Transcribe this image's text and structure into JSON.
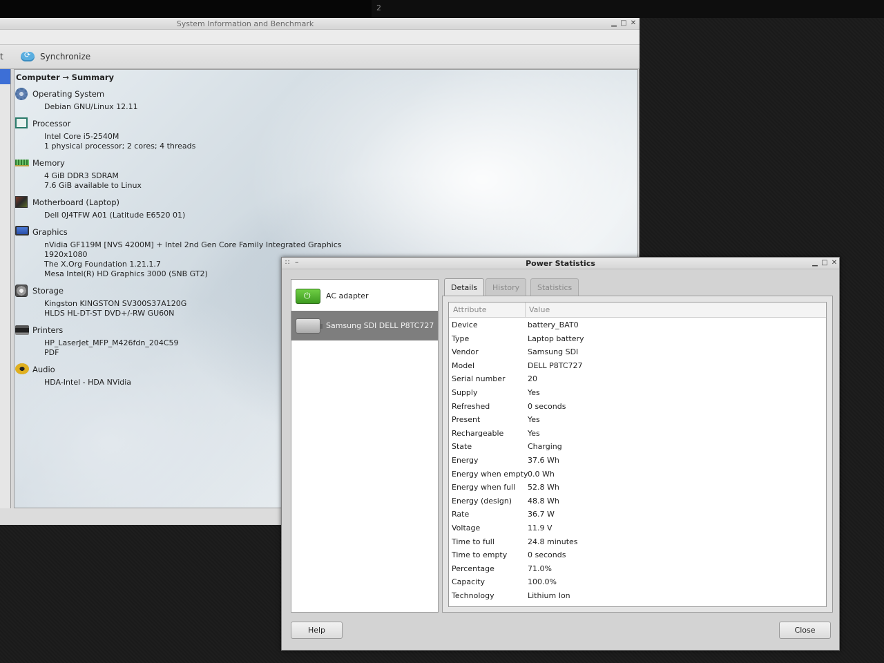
{
  "workspace": {
    "number": "2"
  },
  "sysinfo": {
    "title": "System Information and Benchmark",
    "toolbar": {
      "partial_label": "t",
      "sync_label": "Synchronize"
    },
    "breadcrumb": {
      "root": "Computer",
      "arrow": "→",
      "page": "Summary"
    },
    "sections": [
      {
        "title": "Operating System",
        "icon": "gear-icon",
        "lines": [
          "Debian GNU/Linux 12.11"
        ]
      },
      {
        "title": "Processor",
        "icon": "cpu-icon",
        "lines": [
          "Intel Core i5-2540M",
          "1 physical processor; 2 cores; 4 threads"
        ]
      },
      {
        "title": "Memory",
        "icon": "memory-icon",
        "lines": [
          "4 GiB DDR3 SDRAM",
          "7.6 GiB available to Linux"
        ]
      },
      {
        "title": "Motherboard (Laptop)",
        "icon": "motherboard-icon",
        "lines": [
          "Dell 0J4TFW A01 (Latitude E6520 01)"
        ]
      },
      {
        "title": "Graphics",
        "icon": "monitor-icon",
        "lines": [
          "nVidia GF119M [NVS 4200M] + Intel 2nd Gen Core Family Integrated Graphics",
          "1920x1080",
          "The X.Org Foundation 1.21.1.7",
          "Mesa Intel(R) HD Graphics 3000 (SNB GT2)"
        ]
      },
      {
        "title": "Storage",
        "icon": "disk-icon",
        "lines": [
          "Kingston KINGSTON SV300S37A120G",
          "HLDS HL-DT-ST DVD+/-RW GU60N"
        ]
      },
      {
        "title": "Printers",
        "icon": "printer-icon",
        "lines": [
          "HP_LaserJet_MFP_M426fdn_204C59",
          "PDF"
        ]
      },
      {
        "title": "Audio",
        "icon": "audio-icon",
        "lines": [
          "HDA-Intel - HDA NVidia"
        ]
      }
    ]
  },
  "power": {
    "title": "Power Statistics",
    "devices": [
      {
        "label": "AC adapter",
        "icon": "ac-adapter-icon",
        "selected": false
      },
      {
        "label": "Samsung SDI DELL P8TC727",
        "icon": "battery-icon",
        "selected": true
      }
    ],
    "tabs": [
      {
        "label": "Details",
        "active": true
      },
      {
        "label": "History",
        "active": false
      },
      {
        "label": "Statistics",
        "active": false
      }
    ],
    "table": {
      "headers": {
        "attribute": "Attribute",
        "value": "Value"
      },
      "rows": [
        [
          "Device",
          "battery_BAT0"
        ],
        [
          "Type",
          "Laptop battery"
        ],
        [
          "Vendor",
          "Samsung SDI"
        ],
        [
          "Model",
          "DELL P8TC727"
        ],
        [
          "Serial number",
          "20"
        ],
        [
          "Supply",
          "Yes"
        ],
        [
          "Refreshed",
          "0 seconds"
        ],
        [
          "Present",
          "Yes"
        ],
        [
          "Rechargeable",
          "Yes"
        ],
        [
          "State",
          "Charging"
        ],
        [
          "Energy",
          "37.6 Wh"
        ],
        [
          "Energy when empty",
          "0.0 Wh"
        ],
        [
          "Energy when full",
          "52.8 Wh"
        ],
        [
          "Energy (design)",
          "48.8 Wh"
        ],
        [
          "Rate",
          "36.7 W"
        ],
        [
          "Voltage",
          "11.9 V"
        ],
        [
          "Time to full",
          "24.8 minutes"
        ],
        [
          "Time to empty",
          "0 seconds"
        ],
        [
          "Percentage",
          "71.0%"
        ],
        [
          "Capacity",
          "100.0%"
        ],
        [
          "Technology",
          "Lithium Ion"
        ]
      ]
    },
    "buttons": {
      "help": "Help",
      "close": "Close"
    }
  }
}
